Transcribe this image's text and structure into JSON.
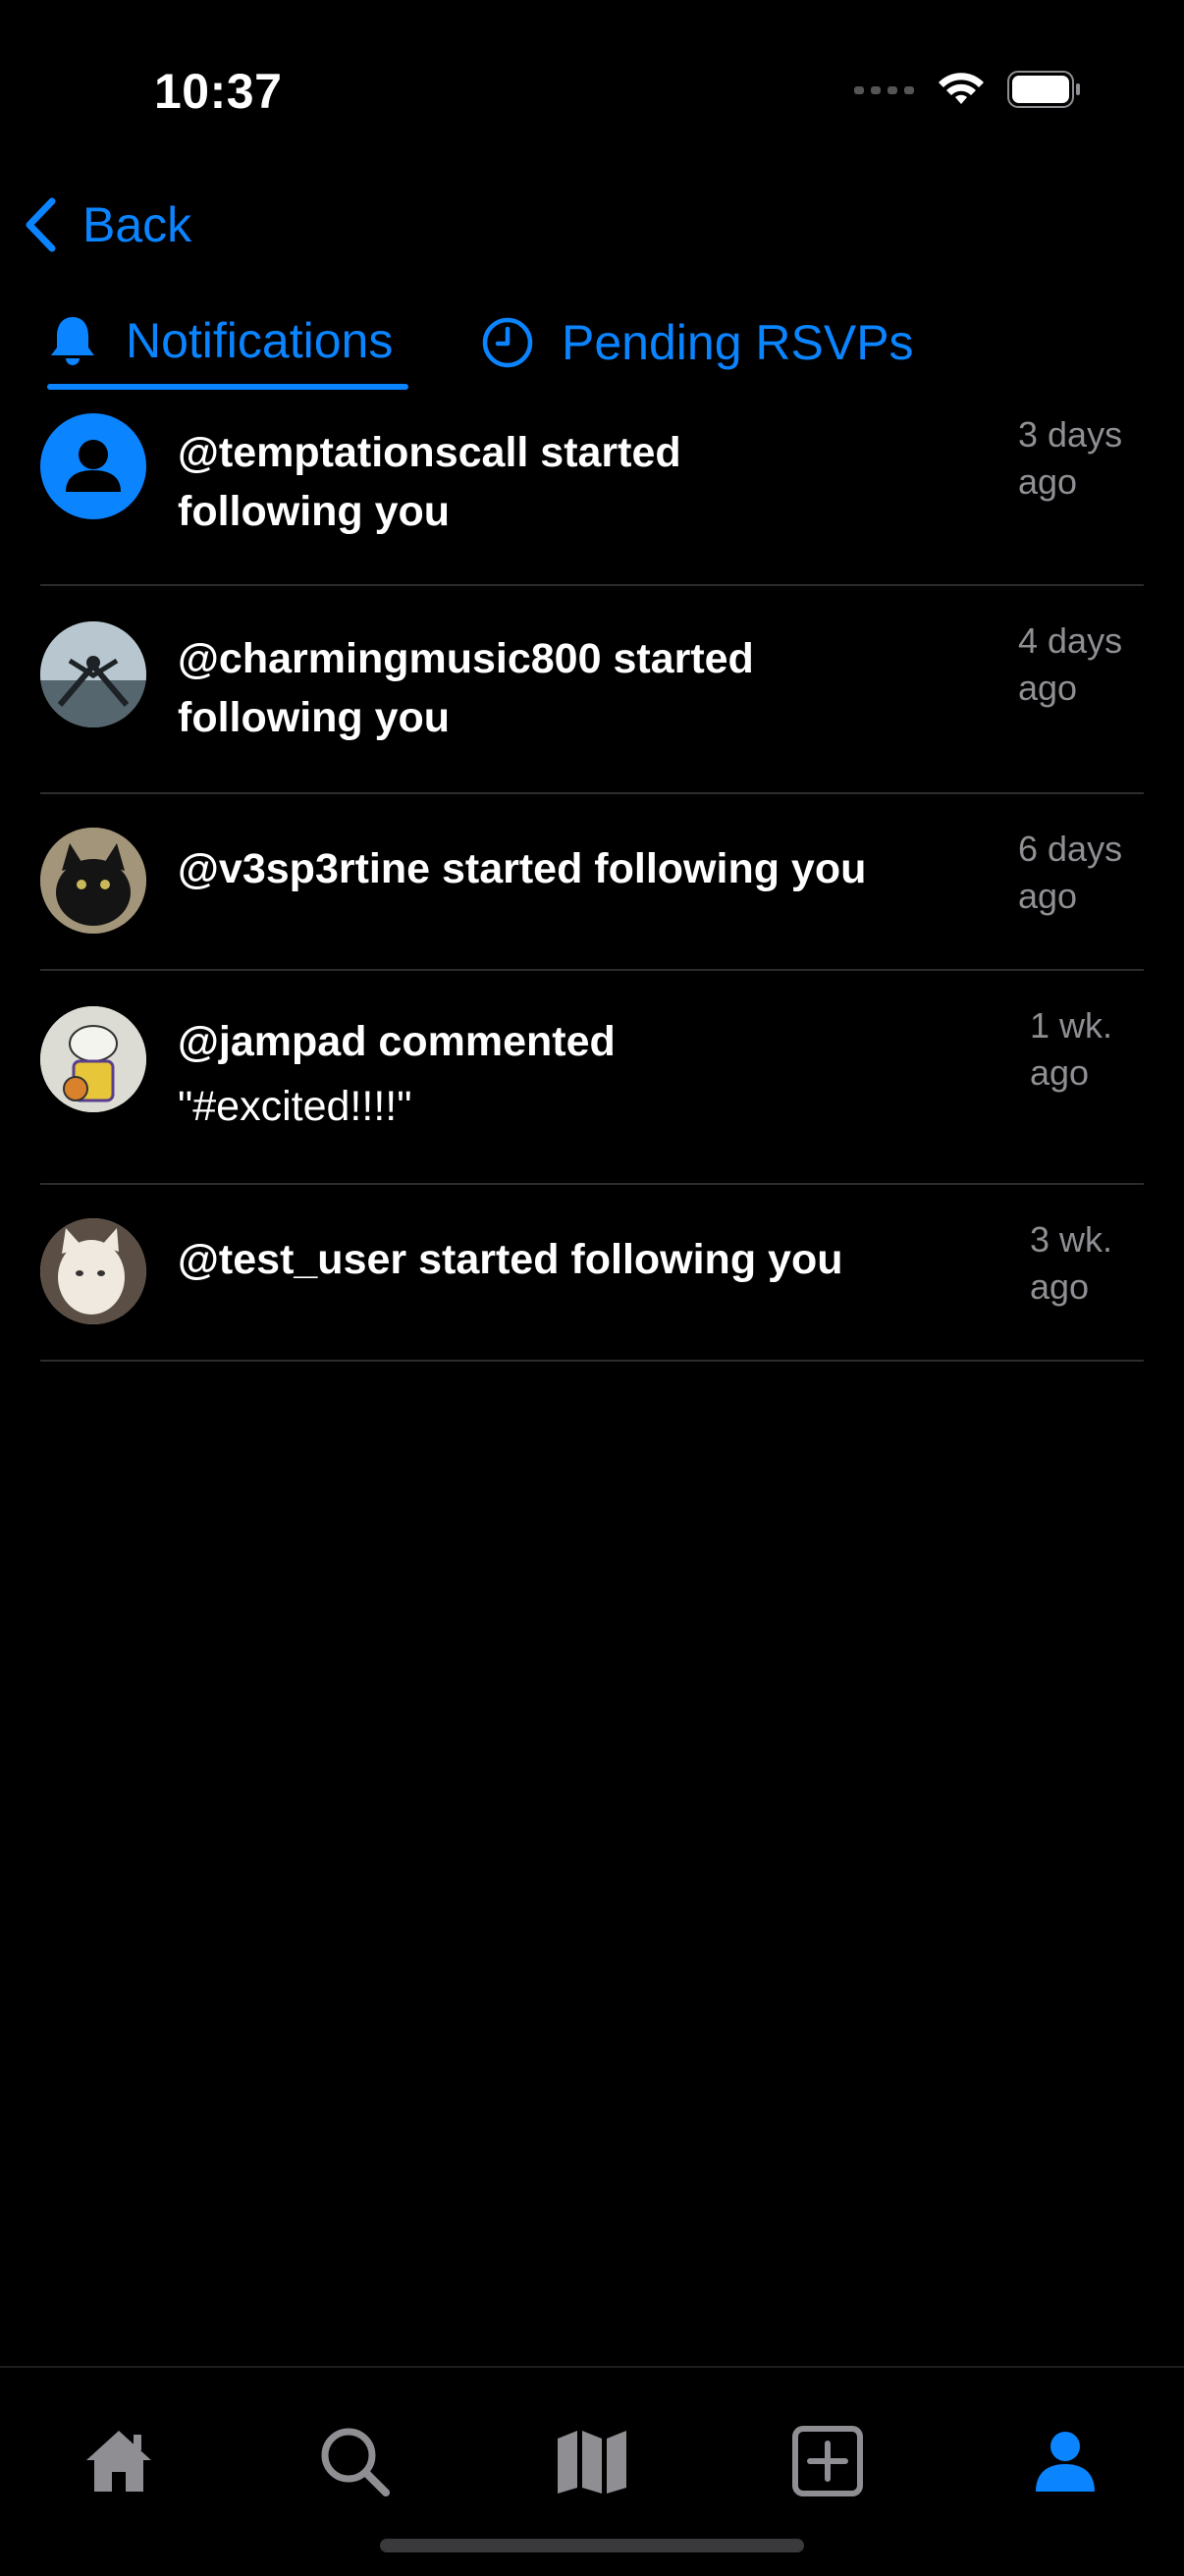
{
  "status_bar": {
    "time": "10:37"
  },
  "nav": {
    "back_label": "Back"
  },
  "tabs": [
    {
      "label": "Notifications",
      "icon": "bell-icon",
      "active": true
    },
    {
      "label": "Pending RSVPs",
      "icon": "clock-icon",
      "active": false
    }
  ],
  "notifications": [
    {
      "line1": "@temptationscall started",
      "line2": "following you",
      "time1": "3 days",
      "time2": "ago"
    },
    {
      "line1": "@charmingmusic800 started",
      "line2": "following you",
      "time1": "4 days",
      "time2": "ago"
    },
    {
      "line1": "@v3sp3rtine started following you",
      "line2": "",
      "time1": "6 days",
      "time2": "ago"
    },
    {
      "line1": "@jampad commented",
      "line2": "\"#excited!!!!\"",
      "time1": "1 wk.",
      "time2": "ago"
    },
    {
      "line1": "@test_user started following you",
      "line2": "",
      "time1": "3 wk.",
      "time2": "ago"
    }
  ],
  "bottom_nav": [
    "home-icon",
    "search-icon",
    "map-icon",
    "add-icon",
    "profile-icon"
  ],
  "colors": {
    "accent": "#0a84ff",
    "background": "#000000",
    "secondary_text": "#8e8e93",
    "divider": "#2c2c2e"
  }
}
